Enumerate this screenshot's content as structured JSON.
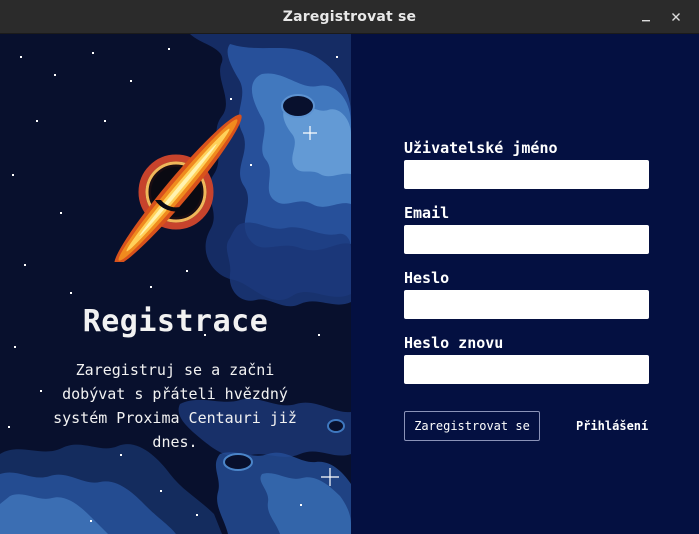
{
  "window": {
    "title": "Zaregistrovat se",
    "controls": {
      "minimize_icon": "minimize-icon",
      "close_icon": "close-icon"
    }
  },
  "hero": {
    "logo_icon": "black-hole-icon",
    "heading": "Registrace",
    "subtitle": "Zaregistruj se a začni dobývat s přáteli hvězdný systém Proxima Centauri již dnes."
  },
  "form": {
    "username": {
      "label": "Uživatelské jméno",
      "value": "",
      "placeholder": ""
    },
    "email": {
      "label": "Email",
      "value": "",
      "placeholder": ""
    },
    "password": {
      "label": "Heslo",
      "value": "",
      "placeholder": ""
    },
    "password_again": {
      "label": "Heslo znovu",
      "value": "",
      "placeholder": ""
    },
    "submit_label": "Zaregistrovat se",
    "login_link": "Přihlášení"
  },
  "colors": {
    "titlebar": "#2b2b2b",
    "left_panel": "#07102e",
    "right_panel": "#041041",
    "text": "#ffffff",
    "accent_orange": "#f2a21a"
  }
}
